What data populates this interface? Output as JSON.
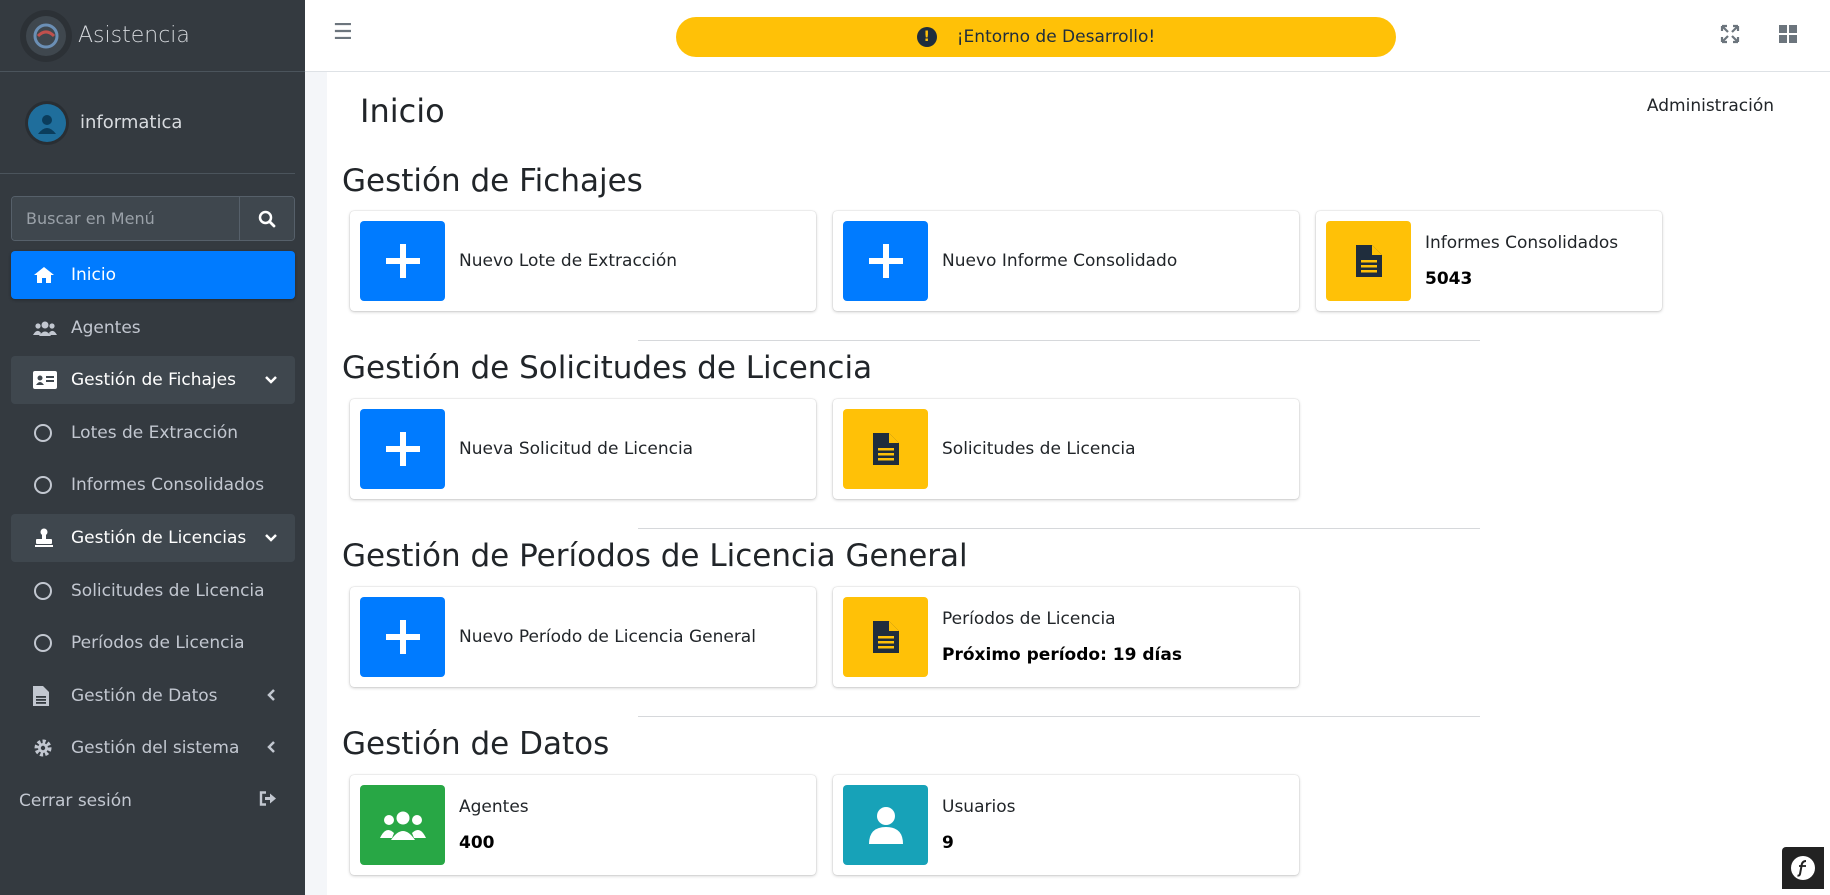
{
  "sidebar": {
    "brand": "Asistencia",
    "user": "informatica",
    "search_placeholder": "Buscar en Menú",
    "items": [
      {
        "label": "Inicio"
      },
      {
        "label": "Agentes"
      },
      {
        "label": "Gestión de Fichajes"
      },
      {
        "label": "Lotes de Extracción"
      },
      {
        "label": "Informes Consolidados"
      },
      {
        "label": "Gestión de Licencias"
      },
      {
        "label": "Solicitudes de Licencia"
      },
      {
        "label": "Períodos de Licencia"
      },
      {
        "label": "Gestión de Datos"
      },
      {
        "label": "Gestión del sistema"
      },
      {
        "label": "Cerrar sesión"
      }
    ]
  },
  "topbar": {
    "banner": "¡Entorno de Desarrollo!"
  },
  "page": {
    "title": "Inicio",
    "admin_link": "Administración"
  },
  "sections": {
    "fichajes": {
      "title": "Gestión de Fichajes",
      "new_batch": "Nuevo Lote de Extracción",
      "new_report": "Nuevo Informe Consolidado",
      "reports": "Informes Consolidados",
      "reports_count": "5043"
    },
    "licencias": {
      "title": "Gestión de Solicitudes de Licencia",
      "new_request": "Nueva Solicitud de Licencia",
      "requests": "Solicitudes de Licencia"
    },
    "periodos": {
      "title": "Gestión de Períodos de Licencia General",
      "new_period": "Nuevo Período de Licencia General",
      "periods": "Períodos de Licencia",
      "next_period": "Próximo período: 19 días"
    },
    "datos": {
      "title": "Gestión de Datos",
      "agents": "Agentes",
      "agents_count": "400",
      "users": "Usuarios",
      "users_count": "9"
    }
  },
  "colors": {
    "primary": "#007bff",
    "warning": "#ffc107",
    "success": "#28a745",
    "info": "#17a2b8",
    "sidebar": "#343a40"
  }
}
